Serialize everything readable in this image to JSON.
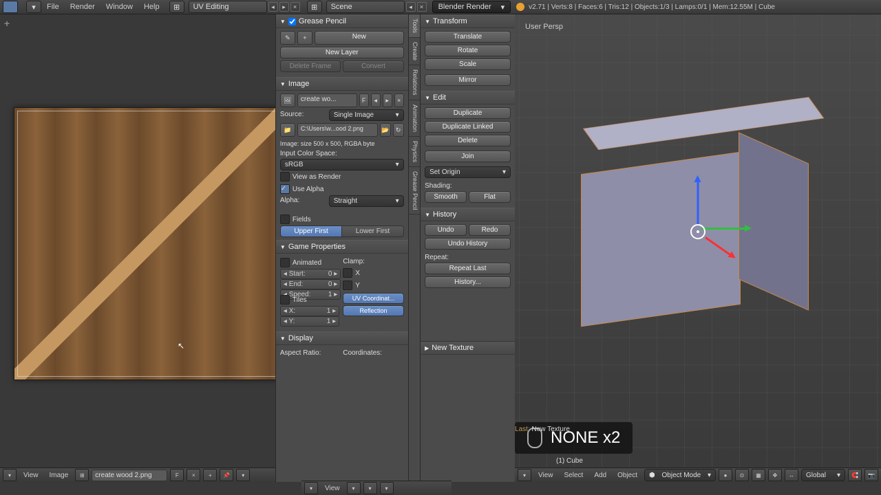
{
  "topbar": {
    "menus": [
      "File",
      "Render",
      "Window",
      "Help"
    ],
    "layout": "UV Editing",
    "scene_label": "Scene",
    "render_engine": "Blender Render",
    "stats": "v2.71 | Verts:8 | Faces:6 | Tris:12 | Objects:1/3 | Lamps:0/1 | Mem:12.55M | Cube"
  },
  "uv_footer": {
    "menus": [
      "View",
      "Image"
    ],
    "image_name": "create wood 2.png"
  },
  "n_panel": {
    "grease_pencil": {
      "title": "Grease Pencil",
      "new": "New",
      "new_layer": "New Layer",
      "delete_frame": "Delete Frame",
      "convert": "Convert"
    },
    "image": {
      "title": "Image",
      "name": "create wo...",
      "source_label": "Source:",
      "source_value": "Single Image",
      "path": "C:\\Users\\w...ood 2.png",
      "info": "Image: size 500 x 500, RGBA byte",
      "colorspace_label": "Input Color Space:",
      "colorspace_value": "sRGB",
      "view_as_render": "View as Render",
      "use_alpha": "Use Alpha",
      "alpha_label": "Alpha:",
      "alpha_value": "Straight",
      "fields": "Fields",
      "upper": "Upper First",
      "lower": "Lower First"
    },
    "game": {
      "title": "Game Properties",
      "animated": "Animated",
      "clamp": "Clamp:",
      "start": "Start:",
      "start_v": "0",
      "end": "End:",
      "end_v": "0",
      "speed": "Speed:",
      "speed_v": "1",
      "clamp_x": "X",
      "clamp_y": "Y",
      "tiles": "Tiles",
      "tiles_x": "X:",
      "tiles_xv": "1",
      "tiles_y": "Y:",
      "tiles_yv": "1",
      "uvcoord": "UV Coordinat...",
      "reflection": "Reflection"
    },
    "display": {
      "title": "Display",
      "aspect": "Aspect Ratio:",
      "coords": "Coordinates:"
    }
  },
  "tshelf_tabs": [
    "Tools",
    "Create",
    "Relations",
    "Animation",
    "Physics",
    "Grease Pencil"
  ],
  "tpanel": {
    "transform": {
      "title": "Transform",
      "translate": "Translate",
      "rotate": "Rotate",
      "scale": "Scale",
      "mirror": "Mirror"
    },
    "edit": {
      "title": "Edit",
      "duplicate": "Duplicate",
      "duplicate_linked": "Duplicate Linked",
      "delete": "Delete",
      "join": "Join",
      "set_origin": "Set Origin"
    },
    "shading": {
      "label": "Shading:",
      "smooth": "Smooth",
      "flat": "Flat"
    },
    "history": {
      "title": "History",
      "undo": "Undo",
      "redo": "Redo",
      "undo_history": "Undo History",
      "repeat": "Repeat:",
      "repeat_last": "Repeat Last",
      "history_btn": "History..."
    },
    "new_texture": "New Texture"
  },
  "viewport": {
    "persp": "User Persp",
    "overlay": "NONE x2",
    "last_op_label": "Last:",
    "last_op_value": "New Texture",
    "obj_name": "(1) Cube"
  },
  "v3d_footer": {
    "menus": [
      "View",
      "Select",
      "Add",
      "Object"
    ],
    "mode": "Object Mode",
    "orientation": "Global"
  }
}
